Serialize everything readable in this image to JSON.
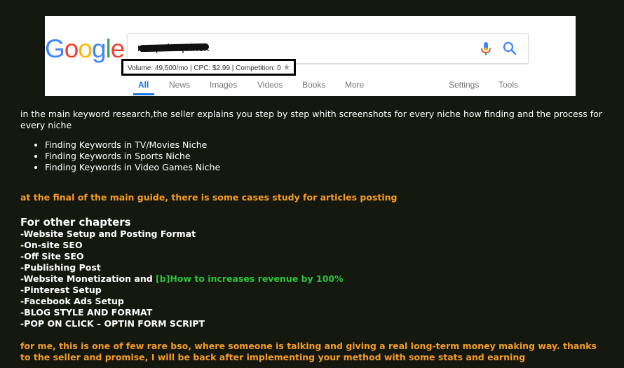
{
  "google": {
    "logo": [
      "G",
      "o",
      "o",
      "g",
      "l",
      "e"
    ],
    "logo_colors": [
      "#4285f4",
      "#ea4335",
      "#fbbc05",
      "#4285f4",
      "#34a853",
      "#ea4335"
    ],
    "search_query": "rampal equinox",
    "mic_icon": "mic-icon",
    "search_icon": "search-icon",
    "keyword_stats": "Volume: 49,500/mo | CPC: $2.99 | Competition: 0",
    "star_icon": "star-icon",
    "tabs": {
      "all": "All",
      "news": "News",
      "images": "Images",
      "videos": "Videos",
      "books": "Books",
      "more": "More",
      "settings": "Settings",
      "tools": "Tools"
    },
    "accent": "#1a73e8"
  },
  "post": {
    "intro": "in the main keyword research,the seller explains you step by step whith screenshots for every niche how finding and the process for every niche",
    "niches": [
      "Finding Keywords in TV/Movies Niche",
      "Finding Keywords in Sports Niche",
      "Finding Keywords in Video Games Niche"
    ],
    "case_study": "at the final of the main guide, there is some cases study for articles posting",
    "chapters_heading": "For other chapters",
    "chapters": {
      "website_setup": "-Website Setup and Posting Format",
      "onsite_seo": "-On-site SEO",
      "offsite_seo": "-Off Site SEO",
      "publishing": "-Publishing Post",
      "monetization": "-Website Monetization and ",
      "monetization_highlight": "[b]How to increases revenue by 100%",
      "pinterest": "-Pinterest Setup",
      "facebook": "-Facebook Ads Setup",
      "blog_style": "-BLOG STYLE AND FORMAT",
      "pop_on_click": "-POP ON CLICK – OPTIN FORM SCRIPT"
    },
    "closing": "for me, this is one of few rare bso, where someone is talking and giving a real long-term money making way. thanks to the seller and promise, I will be back after implementing your method with some stats and earning"
  },
  "colors": {
    "background": "#15180f",
    "orange": "#f39c29",
    "green": "#2ec33b",
    "white": "#ffffff"
  }
}
